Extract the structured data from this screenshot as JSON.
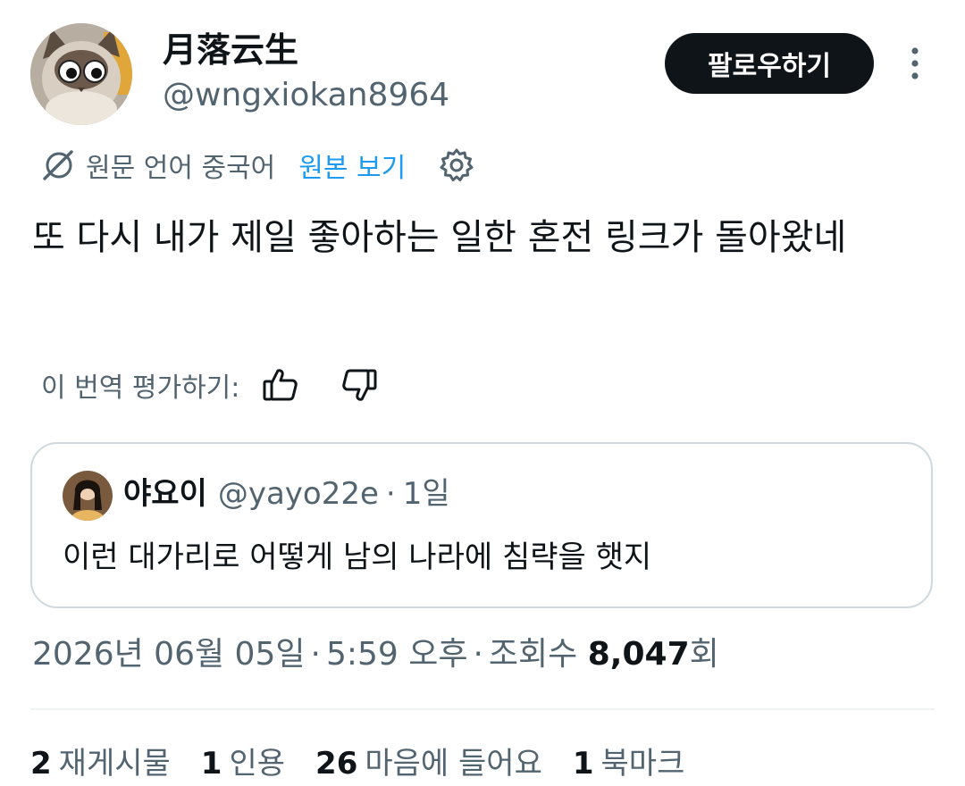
{
  "author": {
    "display_name": "月落云生",
    "handle": "@wngxiokan8964",
    "avatar_icon": "cat-avatar"
  },
  "follow_button": {
    "label": "팔로우하기"
  },
  "more_button": {
    "icon": "more-vertical-icon"
  },
  "translation": {
    "source_language": "원문 언어 중국어",
    "view_original": "원본 보기",
    "translate_icon": "translate-icon",
    "settings_icon": "gear-icon"
  },
  "tweet": {
    "text": "또 다시 내가 제일 좋아하는 일한 혼전 링크가 돌아왔네"
  },
  "rating": {
    "label": "이 번역 평가하기:",
    "thumbs_up_icon": "thumbs-up-icon",
    "thumbs_down_icon": "thumbs-down-icon"
  },
  "quote": {
    "display_name": "야요이",
    "handle": "@yayo22e",
    "separator": "·",
    "time": "1일",
    "text": "이런 대가리로 어떻게 남의 나라에 침략을 햇지"
  },
  "meta": {
    "date": "2026년 06월 05일",
    "separator": "·",
    "time": "5:59 오후",
    "views_label": "조회수",
    "views_count": "8,047",
    "views_suffix": "회"
  },
  "stats": [
    {
      "count": "2",
      "label": "재게시물"
    },
    {
      "count": "1",
      "label": "인용"
    },
    {
      "count": "26",
      "label": "마음에 들어요"
    },
    {
      "count": "1",
      "label": "북마크"
    }
  ],
  "colors": {
    "text_primary": "#0f1419",
    "text_secondary": "#536471",
    "link": "#1d9bf0",
    "border": "#cfd9de",
    "button_bg": "#0f1419"
  }
}
